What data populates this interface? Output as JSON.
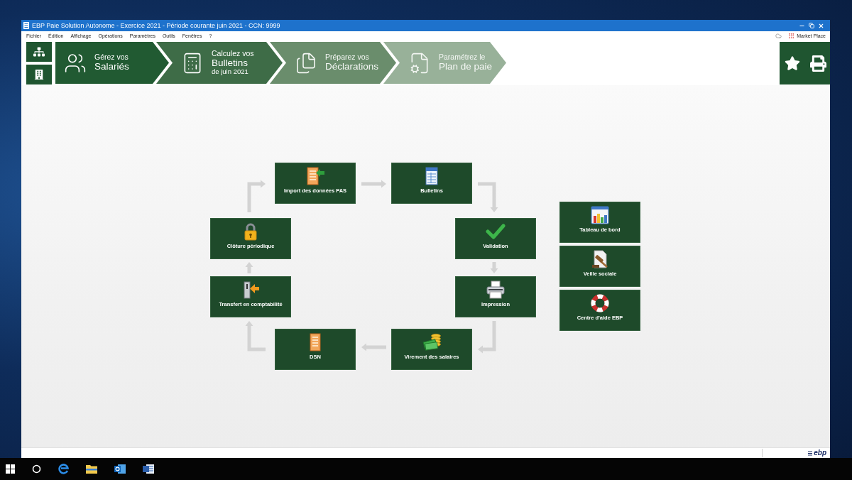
{
  "window": {
    "title": "EBP Paie Solution Autonome - Exercice 2021 - Période courante juin 2021 - CCN: 9999"
  },
  "menu_bar": {
    "items": [
      "Fichier",
      "Édition",
      "Affichage",
      "Opérations",
      "Paramètres",
      "Outils",
      "Fenêtres",
      "?"
    ],
    "market_place": "Market Place"
  },
  "steps": [
    {
      "intro": "Gérez vos",
      "title": "Salariés"
    },
    {
      "intro": "Calculez vos",
      "title": "Bulletins",
      "subtitle": "de juin 2021"
    },
    {
      "intro": "Préparez vos",
      "title": "Déclarations"
    },
    {
      "intro": "Paramétrez le",
      "title": "Plan de paie"
    }
  ],
  "cycle": {
    "tiles": [
      {
        "label": "Import des données PAS"
      },
      {
        "label": "Bulletins"
      },
      {
        "label": "Clôture périodique"
      },
      {
        "label": "Validation"
      },
      {
        "label": "Transfert en comptabilité"
      },
      {
        "label": "Impression"
      },
      {
        "label": "DSN"
      },
      {
        "label": "Virement des salaires"
      }
    ]
  },
  "shortcuts": [
    {
      "label": "Tableau de bord"
    },
    {
      "label": "Veille sociale"
    },
    {
      "label": "Centre d'aide EBP"
    }
  ],
  "status_bar": {
    "logo": "ebp"
  }
}
